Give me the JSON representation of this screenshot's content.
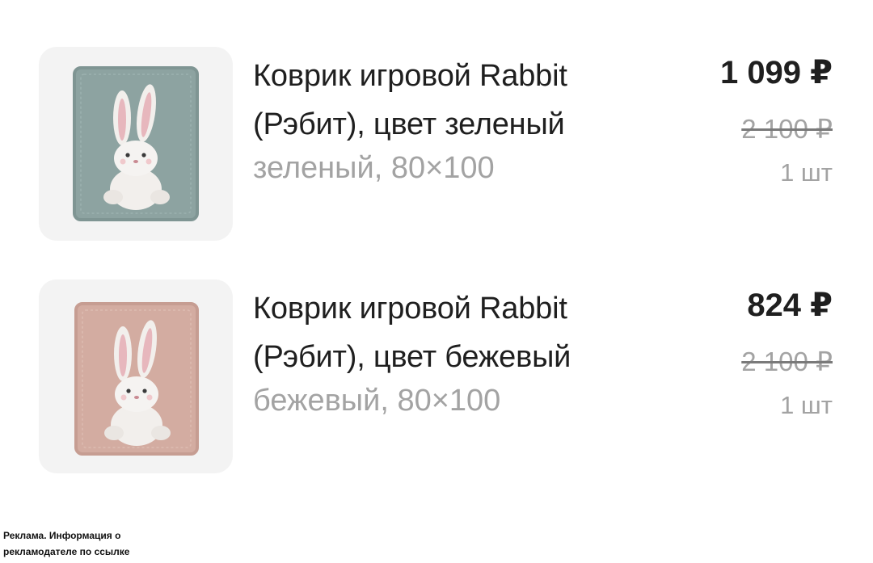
{
  "products": [
    {
      "title_line1": "Коврик игровой Rabbit",
      "title_line2": "(Рэбит), цвет зеленый",
      "variant": "зеленый, 80×100",
      "price": "1 099 ₽",
      "old_price": "2 100 ₽",
      "quantity": "1 шт",
      "image_icon": "rabbit-play-mat-green",
      "mat_color": "#8fa4a2"
    },
    {
      "title_line1": "Коврик игровой Rabbit",
      "title_line2": "(Рэбит), цвет бежевый",
      "variant": "бежевый, 80×100",
      "price": "824 ₽",
      "old_price": "2 100 ₽",
      "quantity": "1 шт",
      "image_icon": "rabbit-play-mat-beige",
      "mat_color": "#d4ada2"
    }
  ],
  "ad_note": {
    "line1": "Реклама. Информация о",
    "line2": "рекламодателе по ссылке"
  }
}
